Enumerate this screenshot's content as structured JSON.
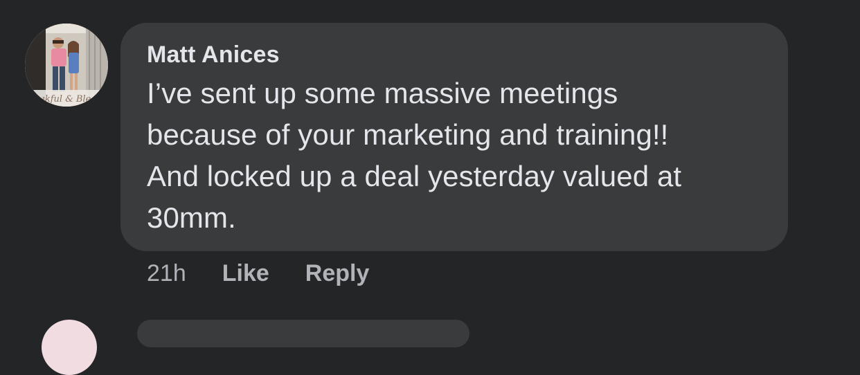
{
  "comment": {
    "author": "Matt Anices",
    "text_lines": [
      "I’ve sent up some massive meetings",
      "because of your marketing and training!!",
      "And locked up a deal yesterday valued at",
      "30mm."
    ],
    "avatar_icon": "profile-photo"
  },
  "actions": {
    "time": "21h",
    "like_label": "Like",
    "reply_label": "Reply"
  },
  "colors": {
    "background": "#242526",
    "bubble": "#3a3b3c",
    "text": "#e4e6eb",
    "meta": "#b0b3b8"
  }
}
